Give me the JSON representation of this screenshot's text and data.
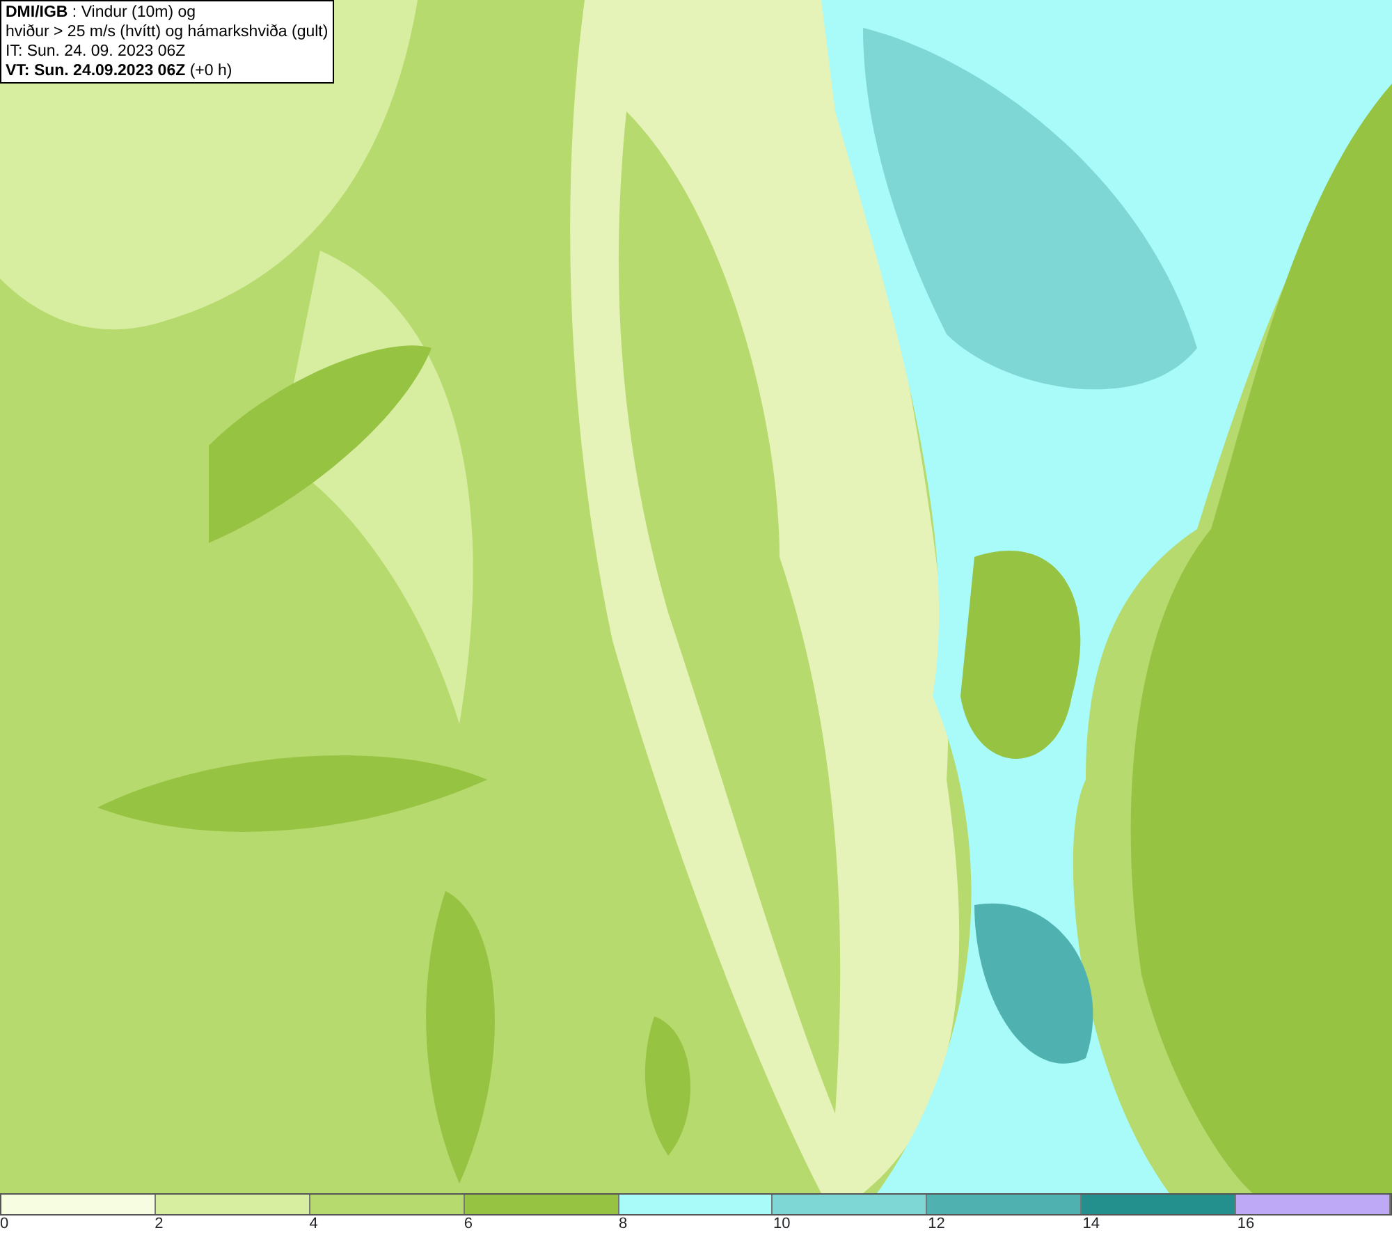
{
  "info_box": {
    "lines": [
      "**DMI/IGB** : Vindur (10m) og",
      "hviður > 25 m/s (hvítt) og hámarkshviða (gult)",
      "IT: Sun. 24. 09. 2023 06Z",
      "**VT: Sun. 24.09.2023 06Z** (+0 h)"
    ]
  },
  "legend": {
    "bins": [
      {
        "color": "#f7fde1",
        "label": "0"
      },
      {
        "color": "#d7eea0",
        "label": "2"
      },
      {
        "color": "#b7da6e",
        "label": "4"
      },
      {
        "color": "#97c343",
        "label": "6"
      },
      {
        "color": "#a8fbf9",
        "label": "8"
      },
      {
        "color": "#7ed6d5",
        "label": "10"
      },
      {
        "color": "#50b2b0",
        "label": "12"
      },
      {
        "color": "#24908d",
        "label": "14"
      },
      {
        "color": "#bda9f6",
        "label": "16"
      }
    ]
  }
}
